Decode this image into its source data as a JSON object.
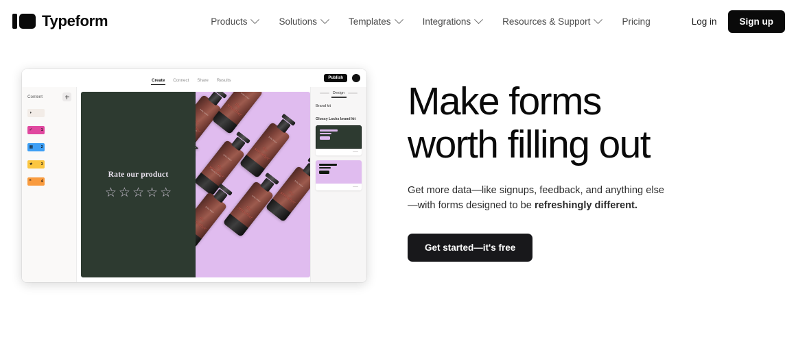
{
  "navbar": {
    "brand": "Typeform",
    "menu": [
      {
        "label": "Products",
        "has_dropdown": true
      },
      {
        "label": "Solutions",
        "has_dropdown": true
      },
      {
        "label": "Templates",
        "has_dropdown": true
      },
      {
        "label": "Integrations",
        "has_dropdown": true
      },
      {
        "label": "Resources & Support",
        "has_dropdown": true
      },
      {
        "label": "Pricing",
        "has_dropdown": false
      }
    ],
    "login": "Log in",
    "signup": "Sign up"
  },
  "hero": {
    "headline": "Make forms\nworth filling out",
    "subhead_line1": "Get more data—like signups, feedback, and anything else",
    "subhead_line2_pre": "—with forms designed to be ",
    "subhead_bold": "refreshingly different.",
    "cta": "Get started—it's free"
  },
  "mockup": {
    "tabs": [
      {
        "label": "Create",
        "active": true
      },
      {
        "label": "Connect",
        "active": false
      },
      {
        "label": "Share",
        "active": false
      },
      {
        "label": "Results",
        "active": false
      }
    ],
    "publish_label": "Publish",
    "sidebar": {
      "title": "Content",
      "add_label": "+",
      "questions": [
        {
          "number": "",
          "icon": "◑",
          "color": "#f2ece7"
        },
        {
          "number": "1",
          "icon": "✓",
          "color": "#e0489f"
        },
        {
          "number": "2",
          "icon": "▦",
          "color": "#3d9ff5"
        },
        {
          "number": "3",
          "icon": "★",
          "color": "#fbc640"
        },
        {
          "number": "4",
          "icon": "❝",
          "color": "#f99b3e"
        }
      ]
    },
    "slide": {
      "title": "Rate our product",
      "stars": [
        "☆",
        "☆",
        "☆",
        "☆",
        "☆"
      ],
      "bg_dark": "#2d3a30",
      "bg_light": "#e0bcef",
      "product_label": "the smoother",
      "product_sub": "body lotion",
      "product_sub2": "250 ml / 8.4 fl oz"
    },
    "design_panel": {
      "tab_label": "Design",
      "section_label": "Brand kit",
      "kit_name": "Glossy Locks brand kit",
      "themes": [
        {
          "name": "dark-theme-card",
          "bg": "#2d3a30"
        },
        {
          "name": "light-theme-card",
          "bg": "#e0bcef"
        }
      ]
    }
  }
}
